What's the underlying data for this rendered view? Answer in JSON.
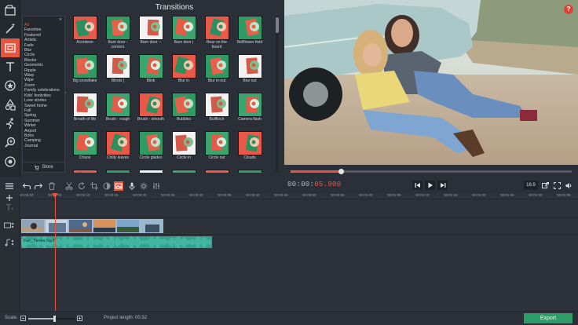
{
  "panel_title": "Transitions",
  "help_label": "?",
  "categories": [
    "All",
    "Favorites",
    "Featured",
    "Artistic",
    "Fade",
    "Blur",
    "Circle",
    "Blocks",
    "Geometric",
    "Ripple",
    "Warp",
    "Wipe",
    "Zoom",
    "Family celebrations",
    "Kids' festivities",
    "Love stories",
    "Sweet home",
    "Fall",
    "Spring",
    "Summer",
    "Winter",
    "Airport",
    "Boho",
    "Camping",
    "Journal"
  ],
  "categories_selected": "All",
  "categories_close": "×",
  "store_label": "Store",
  "transitions": [
    {
      "name": "Acordeon"
    },
    {
      "name": "Barn door - corners"
    },
    {
      "name": "Barn door --"
    },
    {
      "name": "Barn door |"
    },
    {
      "name": "Bear on the board"
    },
    {
      "name": "Bellflower field"
    },
    {
      "name": "Big snowflake"
    },
    {
      "name": "Blinds |"
    },
    {
      "name": "Blink"
    },
    {
      "name": "Blur in"
    },
    {
      "name": "Blur in-out"
    },
    {
      "name": "Blur out"
    },
    {
      "name": "Breath of life"
    },
    {
      "name": "Brush - rough"
    },
    {
      "name": "Brush - smooth"
    },
    {
      "name": "Bubbles"
    },
    {
      "name": "Bullfinch"
    },
    {
      "name": "Camera flash"
    },
    {
      "name": "Chaos"
    },
    {
      "name": "Chilly leaves"
    },
    {
      "name": "Circle glades"
    },
    {
      "name": "Circle in"
    },
    {
      "name": "Circle out"
    },
    {
      "name": "Clouds"
    },
    {
      "name": ""
    },
    {
      "name": ""
    },
    {
      "name": ""
    },
    {
      "name": ""
    },
    {
      "name": ""
    },
    {
      "name": ""
    }
  ],
  "player": {
    "timecode_dim": "00:00:",
    "timecode_accent": "05.900",
    "progress": 0.18,
    "aspect": "16:9"
  },
  "timeline": {
    "ruler": [
      "00:00:00",
      "00:00:05",
      "00:00:10",
      "00:00:15",
      "00:00:20",
      "00:00:25",
      "00:00:30",
      "00:00:35",
      "00:00:40",
      "00:00:45",
      "00:00:50",
      "00:00:55",
      "00:01:00",
      "00:01:05",
      "00:01:10",
      "00:01:15",
      "00:01:20",
      "00:01:25",
      "00:01:30",
      "00:01:35"
    ],
    "audio_clip": "Fun_Times.mp3",
    "playhead_time": "00:00:05.900"
  },
  "bottom": {
    "scale_label": "Scale:",
    "scale_value": 0.55,
    "project_length_label": "Project length:",
    "project_length": "00:32",
    "export_label": "Export"
  },
  "colors": {
    "accent": "#e6553d",
    "export": "#2e9d6a",
    "audio": "#2fa38f",
    "panel": "#2b3038"
  },
  "toolbar_icons": [
    "import-icon",
    "magic-wand-icon",
    "transitions-icon",
    "text-icon",
    "stickers-icon",
    "shapes-icon",
    "sport-icon",
    "zoom-icon",
    "record-icon",
    "menu-icon"
  ],
  "edit_icons": [
    "undo-icon",
    "redo-icon",
    "delete-icon",
    "cut-icon",
    "rotate-icon",
    "crop-icon",
    "color-icon",
    "clip-properties-icon",
    "record-voice-icon",
    "settings-icon",
    "equalizer-icon"
  ]
}
